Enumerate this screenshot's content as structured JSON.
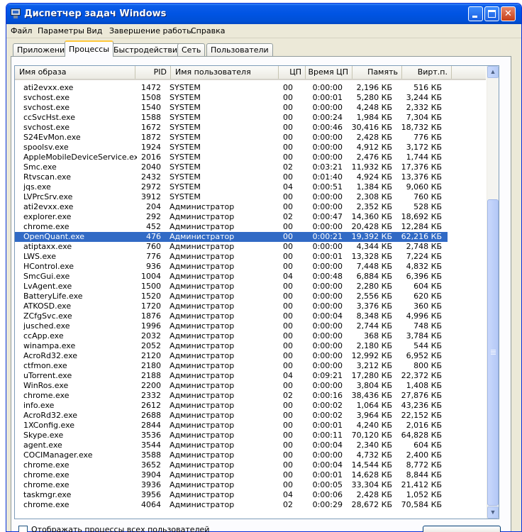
{
  "window": {
    "title": "Диспетчер задач Windows"
  },
  "menu": [
    "Файл",
    "Параметры",
    "Вид",
    "Завершение работы",
    "Справка"
  ],
  "tabs": [
    "Приложения",
    "Процессы",
    "Быстродействие",
    "Сеть",
    "Пользователи"
  ],
  "active_tab": "Процессы",
  "columns": [
    "Имя образа",
    "PID",
    "Имя пользователя",
    "ЦП",
    "Время ЦП",
    "Память",
    "Вирт.п."
  ],
  "processes": [
    {
      "name": "ati2evxx.exe",
      "pid": "1472",
      "user": "SYSTEM",
      "cpu": "00",
      "time": "0:00:00",
      "mem": "2,196 КБ",
      "virt": "516 КБ"
    },
    {
      "name": "svchost.exe",
      "pid": "1508",
      "user": "SYSTEM",
      "cpu": "00",
      "time": "0:00:01",
      "mem": "5,280 КБ",
      "virt": "3,244 КБ"
    },
    {
      "name": "svchost.exe",
      "pid": "1540",
      "user": "SYSTEM",
      "cpu": "00",
      "time": "0:00:00",
      "mem": "4,248 КБ",
      "virt": "2,332 КБ"
    },
    {
      "name": "ccSvcHst.exe",
      "pid": "1588",
      "user": "SYSTEM",
      "cpu": "00",
      "time": "0:00:24",
      "mem": "1,984 КБ",
      "virt": "7,304 КБ"
    },
    {
      "name": "svchost.exe",
      "pid": "1672",
      "user": "SYSTEM",
      "cpu": "00",
      "time": "0:00:46",
      "mem": "30,416 КБ",
      "virt": "18,732 КБ"
    },
    {
      "name": "S24EvMon.exe",
      "pid": "1872",
      "user": "SYSTEM",
      "cpu": "00",
      "time": "0:00:00",
      "mem": "2,428 КБ",
      "virt": "776 КБ"
    },
    {
      "name": "spoolsv.exe",
      "pid": "1924",
      "user": "SYSTEM",
      "cpu": "00",
      "time": "0:00:00",
      "mem": "4,912 КБ",
      "virt": "3,172 КБ"
    },
    {
      "name": "AppleMobileDeviceService.exe",
      "pid": "2016",
      "user": "SYSTEM",
      "cpu": "00",
      "time": "0:00:00",
      "mem": "2,476 КБ",
      "virt": "1,744 КБ"
    },
    {
      "name": "Smc.exe",
      "pid": "2040",
      "user": "SYSTEM",
      "cpu": "02",
      "time": "0:03:21",
      "mem": "11,932 КБ",
      "virt": "17,376 КБ"
    },
    {
      "name": "Rtvscan.exe",
      "pid": "2432",
      "user": "SYSTEM",
      "cpu": "00",
      "time": "0:01:40",
      "mem": "4,924 КБ",
      "virt": "13,376 КБ"
    },
    {
      "name": "jqs.exe",
      "pid": "2972",
      "user": "SYSTEM",
      "cpu": "04",
      "time": "0:00:51",
      "mem": "1,384 КБ",
      "virt": "9,060 КБ"
    },
    {
      "name": "LVPrcSrv.exe",
      "pid": "3912",
      "user": "SYSTEM",
      "cpu": "00",
      "time": "0:00:00",
      "mem": "2,308 КБ",
      "virt": "760 КБ"
    },
    {
      "name": "ati2evxx.exe",
      "pid": "204",
      "user": "Администратор",
      "cpu": "00",
      "time": "0:00:00",
      "mem": "2,352 КБ",
      "virt": "528 КБ"
    },
    {
      "name": "explorer.exe",
      "pid": "292",
      "user": "Администратор",
      "cpu": "02",
      "time": "0:00:47",
      "mem": "14,360 КБ",
      "virt": "18,692 КБ"
    },
    {
      "name": "chrome.exe",
      "pid": "452",
      "user": "Администратор",
      "cpu": "00",
      "time": "0:00:00",
      "mem": "20,428 КБ",
      "virt": "12,284 КБ"
    },
    {
      "name": "OpenQuant.exe",
      "pid": "476",
      "user": "Администратор",
      "cpu": "00",
      "time": "0:00:21",
      "mem": "19,392 КБ",
      "virt": "62,216 КБ",
      "selected": true
    },
    {
      "name": "atiptaxx.exe",
      "pid": "760",
      "user": "Администратор",
      "cpu": "00",
      "time": "0:00:00",
      "mem": "4,344 КБ",
      "virt": "2,748 КБ"
    },
    {
      "name": "LWS.exe",
      "pid": "776",
      "user": "Администратор",
      "cpu": "00",
      "time": "0:00:01",
      "mem": "13,328 КБ",
      "virt": "7,224 КБ"
    },
    {
      "name": "HControl.exe",
      "pid": "936",
      "user": "Администратор",
      "cpu": "00",
      "time": "0:00:00",
      "mem": "7,448 КБ",
      "virt": "4,832 КБ"
    },
    {
      "name": "SmcGui.exe",
      "pid": "1004",
      "user": "Администратор",
      "cpu": "04",
      "time": "0:00:48",
      "mem": "6,884 КБ",
      "virt": "6,396 КБ"
    },
    {
      "name": "LvAgent.exe",
      "pid": "1500",
      "user": "Администратор",
      "cpu": "00",
      "time": "0:00:00",
      "mem": "2,280 КБ",
      "virt": "604 КБ"
    },
    {
      "name": "BatteryLife.exe",
      "pid": "1520",
      "user": "Администратор",
      "cpu": "00",
      "time": "0:00:00",
      "mem": "2,556 КБ",
      "virt": "620 КБ"
    },
    {
      "name": "ATKOSD.exe",
      "pid": "1720",
      "user": "Администратор",
      "cpu": "00",
      "time": "0:00:00",
      "mem": "3,376 КБ",
      "virt": "360 КБ"
    },
    {
      "name": "ZCfgSvc.exe",
      "pid": "1876",
      "user": "Администратор",
      "cpu": "00",
      "time": "0:00:04",
      "mem": "8,348 КБ",
      "virt": "4,996 КБ"
    },
    {
      "name": "jusched.exe",
      "pid": "1996",
      "user": "Администратор",
      "cpu": "00",
      "time": "0:00:00",
      "mem": "2,744 КБ",
      "virt": "748 КБ"
    },
    {
      "name": "ccApp.exe",
      "pid": "2032",
      "user": "Администратор",
      "cpu": "00",
      "time": "0:00:00",
      "mem": "368 КБ",
      "virt": "3,784 КБ"
    },
    {
      "name": "winampa.exe",
      "pid": "2052",
      "user": "Администратор",
      "cpu": "00",
      "time": "0:00:00",
      "mem": "2,180 КБ",
      "virt": "544 КБ"
    },
    {
      "name": "AcroRd32.exe",
      "pid": "2120",
      "user": "Администратор",
      "cpu": "00",
      "time": "0:00:00",
      "mem": "12,992 КБ",
      "virt": "6,952 КБ"
    },
    {
      "name": "ctfmon.exe",
      "pid": "2180",
      "user": "Администратор",
      "cpu": "00",
      "time": "0:00:00",
      "mem": "3,212 КБ",
      "virt": "800 КБ"
    },
    {
      "name": "uTorrent.exe",
      "pid": "2188",
      "user": "Администратор",
      "cpu": "04",
      "time": "0:09:21",
      "mem": "17,280 КБ",
      "virt": "22,372 КБ"
    },
    {
      "name": "WinRos.exe",
      "pid": "2200",
      "user": "Администратор",
      "cpu": "00",
      "time": "0:00:00",
      "mem": "3,804 КБ",
      "virt": "1,408 КБ"
    },
    {
      "name": "chrome.exe",
      "pid": "2332",
      "user": "Администратор",
      "cpu": "02",
      "time": "0:00:16",
      "mem": "38,436 КБ",
      "virt": "27,876 КБ"
    },
    {
      "name": "info.exe",
      "pid": "2612",
      "user": "Администратор",
      "cpu": "00",
      "time": "0:00:02",
      "mem": "1,064 КБ",
      "virt": "43,236 КБ"
    },
    {
      "name": "AcroRd32.exe",
      "pid": "2688",
      "user": "Администратор",
      "cpu": "00",
      "time": "0:00:02",
      "mem": "3,964 КБ",
      "virt": "22,152 КБ"
    },
    {
      "name": "1XConfig.exe",
      "pid": "2844",
      "user": "Администратор",
      "cpu": "00",
      "time": "0:00:01",
      "mem": "4,240 КБ",
      "virt": "2,016 КБ"
    },
    {
      "name": "Skype.exe",
      "pid": "3536",
      "user": "Администратор",
      "cpu": "00",
      "time": "0:00:11",
      "mem": "70,120 КБ",
      "virt": "64,828 КБ"
    },
    {
      "name": "agent.exe",
      "pid": "3544",
      "user": "Администратор",
      "cpu": "00",
      "time": "0:00:04",
      "mem": "2,340 КБ",
      "virt": "604 КБ"
    },
    {
      "name": "COCIManager.exe",
      "pid": "3588",
      "user": "Администратор",
      "cpu": "00",
      "time": "0:00:00",
      "mem": "4,732 КБ",
      "virt": "2,400 КБ"
    },
    {
      "name": "chrome.exe",
      "pid": "3652",
      "user": "Администратор",
      "cpu": "00",
      "time": "0:00:04",
      "mem": "14,544 КБ",
      "virt": "8,772 КБ"
    },
    {
      "name": "chrome.exe",
      "pid": "3904",
      "user": "Администратор",
      "cpu": "00",
      "time": "0:00:01",
      "mem": "14,628 КБ",
      "virt": "8,844 КБ"
    },
    {
      "name": "chrome.exe",
      "pid": "3936",
      "user": "Администратор",
      "cpu": "00",
      "time": "0:00:05",
      "mem": "33,304 КБ",
      "virt": "21,412 КБ"
    },
    {
      "name": "taskmgr.exe",
      "pid": "3956",
      "user": "Администратор",
      "cpu": "04",
      "time": "0:00:06",
      "mem": "2,428 КБ",
      "virt": "1,052 КБ"
    },
    {
      "name": "chrome.exe",
      "pid": "4064",
      "user": "Администратор",
      "cpu": "02",
      "time": "0:00:29",
      "mem": "28,672 КБ",
      "virt": "70,584 КБ"
    }
  ],
  "show_all_users_label": "Отображать процессы всех пользователей",
  "colors": {
    "title_bar": "#0054e3",
    "selection": "#316ac5",
    "window_bg": "#ece9d8",
    "tab_highlight": "#ffc83c"
  }
}
